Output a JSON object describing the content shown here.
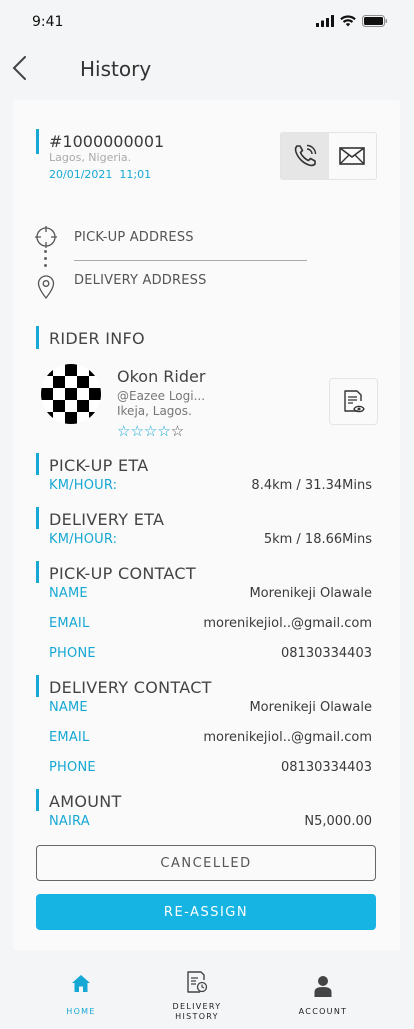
{
  "status_bar": {
    "time": "9:41"
  },
  "header": {
    "title": "History"
  },
  "order": {
    "id": "#1000000001",
    "location": "Lagos, Nigeria.",
    "date": "20/01/2021",
    "time": "11;01"
  },
  "addresses": {
    "pickup_label": "PICK-UP ADDRESS",
    "delivery_label": "DELIVERY ADDRESS"
  },
  "rider": {
    "section_title": "RIDER INFO",
    "name": "Okon Rider",
    "handle": "@Eazee Logi...",
    "location": "Ikeja, Lagos.",
    "rating": 4,
    "rating_max": 5,
    "stars_on": "☆☆☆☆",
    "stars_off": "☆"
  },
  "pickup_eta": {
    "title": "PICK-UP ETA",
    "key": "KM/HOUR:",
    "value": "8.4km / 31.34Mins"
  },
  "delivery_eta": {
    "title": "DELIVERY ETA",
    "key": "KM/HOUR:",
    "value": "5km / 18.66Mins"
  },
  "pickup_contact": {
    "title": "PICK-UP CONTACT",
    "name_key": "NAME",
    "name": "Morenikeji Olawale",
    "email_key": "EMAIL",
    "email": "morenikejiol..@gmail.com",
    "phone_key": "PHONE",
    "phone": "08130334403"
  },
  "delivery_contact": {
    "title": "DELIVERY CONTACT",
    "name_key": "NAME",
    "name": "Morenikeji Olawale",
    "email_key": "EMAIL",
    "email": "morenikejiol..@gmail.com",
    "phone_key": "PHONE",
    "phone": "08130334403"
  },
  "amount": {
    "title": "AMOUNT",
    "key": "NAIRA",
    "value": "N5,000.00"
  },
  "actions": {
    "cancelled_label": "CANCELLED",
    "reassign_label": "RE-ASSIGN"
  },
  "nav": {
    "home": "HOME",
    "history_line1": "DELIVERY",
    "history_line2": "HISTORY",
    "account": "ACCOUNT"
  },
  "colors": {
    "accent": "#16a8d4",
    "button": "#16b4e2"
  },
  "icons": [
    "back-chevron-icon",
    "phone-icon",
    "mail-icon",
    "crosshair-icon",
    "location-pin-icon",
    "document-eye-icon",
    "home-icon",
    "delivery-history-icon",
    "account-icon"
  ]
}
